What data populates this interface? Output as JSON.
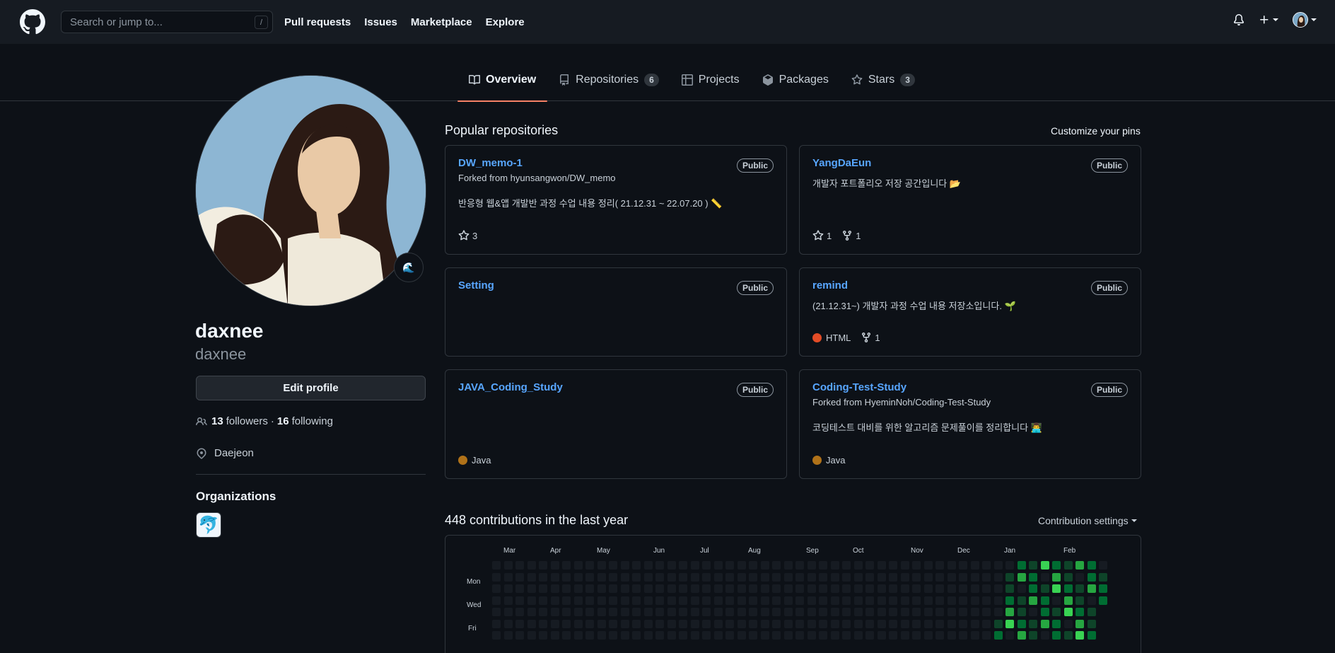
{
  "header": {
    "search_placeholder": "Search or jump to...",
    "search_shortcut": "/",
    "nav": [
      "Pull requests",
      "Issues",
      "Marketplace",
      "Explore"
    ]
  },
  "tabs": [
    {
      "label": "Overview",
      "icon": "book-icon",
      "count": ""
    },
    {
      "label": "Repositories",
      "icon": "repo-icon",
      "count": "6"
    },
    {
      "label": "Projects",
      "icon": "table-icon",
      "count": ""
    },
    {
      "label": "Packages",
      "icon": "package-icon",
      "count": ""
    },
    {
      "label": "Stars",
      "icon": "star-icon",
      "count": "3"
    }
  ],
  "profile": {
    "name": "daxnee",
    "login": "daxnee",
    "edit_label": "Edit profile",
    "followers_count": "13",
    "followers_label": "followers",
    "separator": "·",
    "following_count": "16",
    "following_label": "following",
    "location": "Daejeon",
    "status_emoji": "🌊",
    "orgs_title": "Organizations",
    "org_emoji": "🐬"
  },
  "popular": {
    "title": "Popular repositories",
    "customize": "Customize your pins",
    "repos": [
      {
        "name": "DW_memo-1",
        "visibility": "Public",
        "forked": "Forked from hyunsangwon/DW_memo",
        "description": "반응형 웹&앱 개발반 과정 수업 내용 정리( 21.12.31 ~ 22.07.20 ) 📏",
        "language": "",
        "stars": "3",
        "forks": ""
      },
      {
        "name": "YangDaEun",
        "visibility": "Public",
        "forked": "",
        "description": "개발자 포트폴리오 저장 공간입니다 📂",
        "language": "",
        "stars": "1",
        "forks": "1"
      },
      {
        "name": "Setting",
        "visibility": "Public",
        "forked": "",
        "description": "",
        "language": "",
        "stars": "",
        "forks": ""
      },
      {
        "name": "remind",
        "visibility": "Public",
        "forked": "",
        "description": "(21.12.31~) 개발자 과정 수업 내용 저장소입니다. 🌱",
        "language": "HTML",
        "stars": "",
        "forks": "1"
      },
      {
        "name": "JAVA_Coding_Study",
        "visibility": "Public",
        "forked": "",
        "description": "",
        "language": "Java",
        "stars": "",
        "forks": ""
      },
      {
        "name": "Coding-Test-Study",
        "visibility": "Public",
        "forked": "Forked from HyeminNoh/Coding-Test-Study",
        "description": "코딩테스트 대비를 위한 알고리즘 문제풀이를 정리합니다 👨‍💻",
        "language": "Java",
        "stars": "",
        "forks": ""
      }
    ],
    "language_colors": {
      "HTML": "#e34c26",
      "Java": "#b07219"
    }
  },
  "contributions": {
    "title": "448 contributions in the last year",
    "settings_label": "Contribution settings",
    "months": [
      "Mar",
      "Apr",
      "May",
      "Jun",
      "Jul",
      "Aug",
      "Sep",
      "Oct",
      "Nov",
      "Dec",
      "Jan",
      "Feb"
    ],
    "days": [
      "Mon",
      "Wed",
      "Fri"
    ],
    "colors": [
      "#161b22",
      "#0e4429",
      "#006d32",
      "#26a641",
      "#39d353"
    ]
  }
}
